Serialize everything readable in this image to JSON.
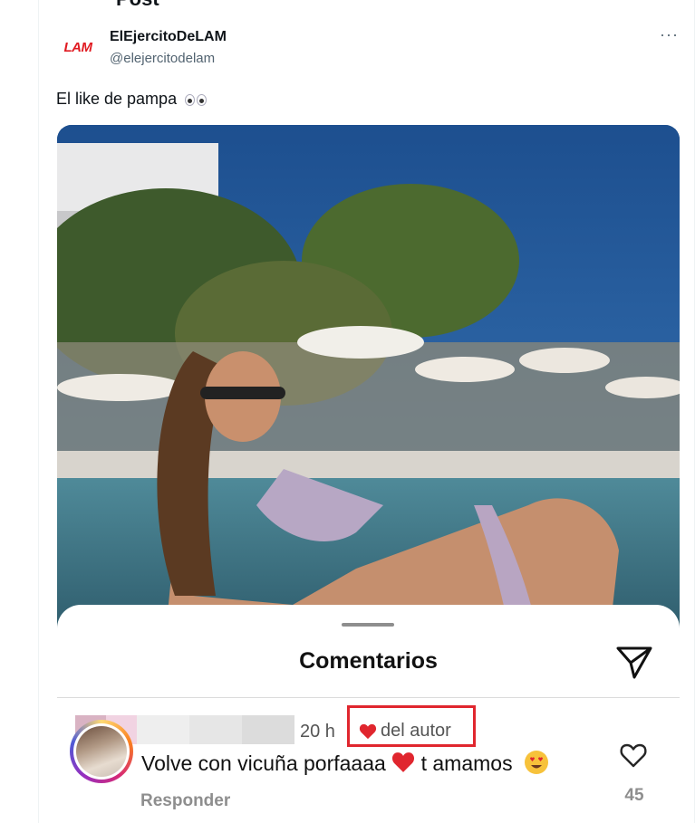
{
  "header": {
    "title_partial": "Post"
  },
  "tweet": {
    "avatar_logo_text": "LAM",
    "author_name": "ElEjercitoDeLAM",
    "author_handle": "@elejercitodelam",
    "more_label": "···",
    "text": "El like de pampa",
    "text_emoji": "eyes-icon"
  },
  "comments_sheet": {
    "title": "Comentarios",
    "share_icon": "paper-plane-icon",
    "comment": {
      "username_hidden": true,
      "time": "20 h",
      "author_like_label": "del autor",
      "author_like_icon": "heart-icon",
      "text_part1": "Volve con vicuña porfaaaa",
      "text_part2": " t amamos ",
      "reply_label": "Responder",
      "like_count": "45"
    }
  },
  "colors": {
    "highlight_box": "#e0262e",
    "heart": "#e0262e",
    "brand_logo": "#e01b22",
    "handle": "#536471"
  }
}
